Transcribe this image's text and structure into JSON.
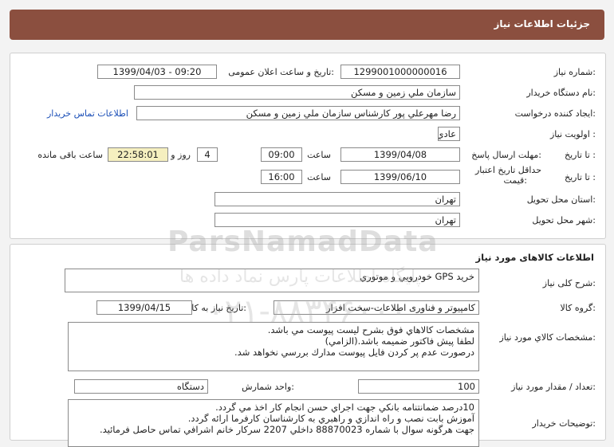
{
  "header": {
    "title": "جزئیات اطلاعات نیاز"
  },
  "info": {
    "need_number_label": "شماره نیاز:",
    "need_number": "1299001000000016",
    "announce_label": "تاریخ و ساعت اعلان عمومی:",
    "announce_value": "1399/04/03 - 09:20",
    "buyer_org_label": "نام دستگاه خریدار:",
    "buyer_org": "سازمان ملي زمين و مسكن",
    "requester_label": "ایجاد کننده درخواست:",
    "requester": "رضا مهرعلي پور كارشناس سازمان ملي زمين و مسكن",
    "contact_link": "اطلاعات تماس خریدار",
    "priority_label": "اولویت نیاز :",
    "priority": "عادي",
    "deadline_label": "مهلت ارسال پاسخ:",
    "until_date_label": "تا تاریخ :",
    "deadline_date": "1399/04/08",
    "time_label": "ساعت",
    "deadline_time": "09:00",
    "days": "4",
    "days_label": "روز و",
    "remaining_time": "22:58:01",
    "remaining_label": "ساعت باقی مانده",
    "validity_label_1": "حداقل تاریخ اعتبار",
    "validity_label_2": "قیمت:",
    "validity_date": "1399/06/10",
    "validity_time": "16:00",
    "province_label": "استان محل تحویل:",
    "province": "تهران",
    "city_label": "شهر محل تحویل:",
    "city": "تهران"
  },
  "goods": {
    "section_title": "اطلاعات کالاهای مورد نیاز",
    "summary_label": "شرح کلی نیاز:",
    "summary": "خريد GPS خودرويي و موتوري",
    "group_label": "گروه کالا:",
    "group": "کامپیوتر و فناوری اطلاعات-سخت افزار",
    "need_date_label": "تاریخ نیاز به کالا:",
    "need_date": "1399/04/15",
    "spec_label": "مشخصات کالاي مورد نياز:",
    "spec_lines": [
      "مشخصات كالاهاي فوق بشرح ليست پيوست مي باشد.",
      "لطفا پيش فاكتور ضميمه باشد.(الزامي)",
      "درصورت عدم پر كردن فايل پيوست مدارك بررسي نخواهد شد."
    ],
    "qty_label": "تعداد / مقدار مورد نیاز:",
    "qty": "100",
    "unit_label": "واحد شمارش:",
    "unit": "دستگاه",
    "buyer_notes_label": "توضیحات خریدار:",
    "notes_lines": [
      "10درصد ضمانتنامه بانكي جهت اجراي حسن انجام كار اخذ مي گردد.",
      "آموزش بابت نصب و راه اندازي و راهبري به كارشناسان كارفرما ارائه گردد.",
      "جهت هرگونه سوال با شماره 88870023 داخلي 2207 سركار خانم اشرافي تماس حاصل فرمائيد."
    ]
  },
  "watermark": {
    "latin": "ParsNamadData",
    "persian": "پایگاه اطلاعات پارس نماد داده ها",
    "phone": "۰۲۱-۸۸۳۴۶۰۰۰"
  }
}
